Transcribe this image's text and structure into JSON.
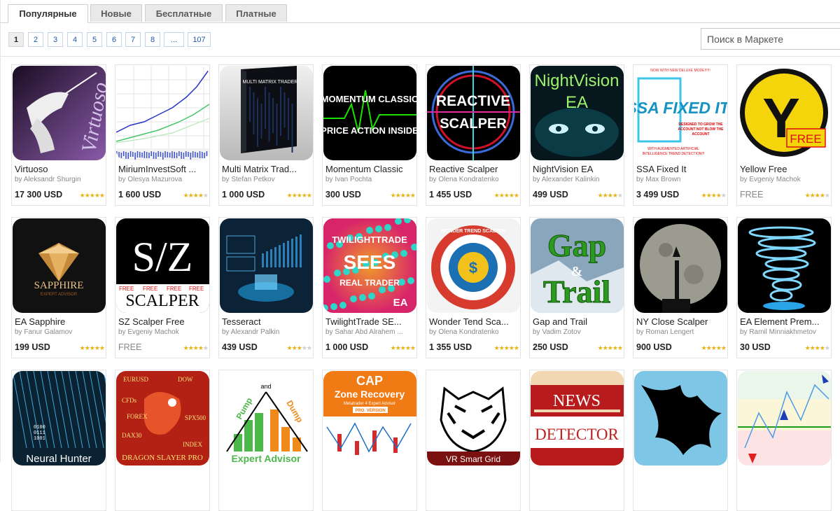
{
  "tabs": [
    "Популярные",
    "Новые",
    "Бесплатные",
    "Платные"
  ],
  "pagination": {
    "pages": [
      "1",
      "2",
      "3",
      "4",
      "5",
      "6",
      "7",
      "8",
      "...",
      "107"
    ],
    "current": "1"
  },
  "search": {
    "placeholder": "Поиск в Маркете"
  },
  "products": [
    {
      "name": "Virtuoso",
      "author": "by Aleksandr Shurgin",
      "price": "17 300 USD",
      "rating": 5,
      "thumb": "virtuoso",
      "thumb_text": [
        "Virtuoso"
      ]
    },
    {
      "name": "MiriumInvestSoft ...",
      "author": "by Olesya Mazurova",
      "price": "1 600 USD",
      "rating": 4,
      "thumb": "mirium",
      "thumb_text": []
    },
    {
      "name": "Multi Matrix Trad...",
      "author": "by Stefan Petkov",
      "price": "1 000 USD",
      "rating": 5,
      "thumb": "matrix",
      "thumb_text": [
        "MULTI MATRIX TRADER"
      ]
    },
    {
      "name": "Momentum Classic",
      "author": "by Ivan Pochta",
      "price": "300 USD",
      "rating": 5,
      "thumb": "momentum",
      "thumb_text": [
        "MOMENTUM CLASSIC",
        "PRICE ACTION INSIDE"
      ]
    },
    {
      "name": "Reactive Scalper",
      "author": "by Olena Kondratenko",
      "price": "1 455 USD",
      "rating": 5,
      "thumb": "reactive",
      "thumb_text": [
        "REACTIVE",
        "SCALPER"
      ]
    },
    {
      "name": "NightVision EA",
      "author": "by Alexander Kalinkin",
      "price": "499 USD",
      "rating": 4,
      "thumb": "nightvision",
      "thumb_text": [
        "NightVision",
        "EA"
      ]
    },
    {
      "name": "SSA Fixed It",
      "author": "by Max Brown",
      "price": "3 499 USD",
      "rating": 4,
      "thumb": "ssa",
      "thumb_text": [
        "NOW WITH NEW DELUXE MODE!!!!!!",
        "SSA FIXED IT!",
        "DESIGNED TO GROW THE",
        "ACCOUNT NOT BLOW THE",
        "ACCOUNT",
        "WITH AUGMENTED ARTIFICIAL",
        "INTELLIGENCE TREND DETECTION!!!"
      ]
    },
    {
      "name": "Yellow Free",
      "author": "by Evgeniy Machok",
      "price": "FREE",
      "rating": 4,
      "thumb": "yellow",
      "thumb_text": [
        "Y",
        "FREE"
      ]
    },
    {
      "name": "EA Sapphire",
      "author": "by Fanur Galamov",
      "price": "199 USD",
      "rating": 5,
      "thumb": "sapphire",
      "thumb_text": [
        "SAPPHIRE",
        "EXPERT ADVISOR"
      ]
    },
    {
      "name": "SZ Scalper Free",
      "author": "by Evgeniy Machok",
      "price": "FREE",
      "rating": 4,
      "thumb": "sz",
      "thumb_text": [
        "S/Z",
        "FREE",
        "FREE",
        "FREE",
        "FREE",
        "SCALPER"
      ]
    },
    {
      "name": "Tesseract",
      "author": "by Alexandr Palkin",
      "price": "439 USD",
      "rating": 3,
      "thumb": "tesseract",
      "thumb_text": []
    },
    {
      "name": "TwilightTrade SE...",
      "author": "by Sahar Abd Alrahem ...",
      "price": "1 000 USD",
      "rating": 5,
      "thumb": "twilight",
      "thumb_text": [
        "TWILIGHTTRADE",
        "SEES",
        "REAL TRADER",
        "EA"
      ]
    },
    {
      "name": "Wonder Tend Sca...",
      "author": "by Olena Kondratenko",
      "price": "1 355 USD",
      "rating": 5,
      "thumb": "wonder",
      "thumb_text": [
        "WONDER TREND SCALPER",
        "$"
      ]
    },
    {
      "name": "Gap and Trail",
      "author": "by Vadim Zotov",
      "price": "250 USD",
      "rating": 5,
      "thumb": "gap",
      "thumb_text": [
        "Gap",
        "&",
        "Trail"
      ]
    },
    {
      "name": "NY Close Scalper",
      "author": "by Roman Lengert",
      "price": "900 USD",
      "rating": 5,
      "thumb": "ny",
      "thumb_text": []
    },
    {
      "name": "EA Element Prem...",
      "author": "by Ramil Minniakhmetov",
      "price": "30 USD",
      "rating": 4,
      "thumb": "element",
      "thumb_text": []
    },
    {
      "name": "",
      "author": "",
      "price": "",
      "rating": 0,
      "thumb": "neural",
      "thumb_text": [
        "Neural Hunter",
        "0100",
        "0111",
        "1001"
      ]
    },
    {
      "name": "",
      "author": "",
      "price": "",
      "rating": 0,
      "thumb": "dragon",
      "thumb_text": [
        "EURUSD",
        "DOW",
        "CFDs",
        "FOREX",
        "SPX500",
        "DAX30",
        "INDEX",
        "DRAGON SLAYER PRO"
      ]
    },
    {
      "name": "",
      "author": "",
      "price": "",
      "rating": 0,
      "thumb": "pump",
      "thumb_text": [
        "and",
        "Pump",
        "Dump",
        "Expert Advisor"
      ]
    },
    {
      "name": "",
      "author": "",
      "price": "",
      "rating": 0,
      "thumb": "cap",
      "thumb_text": [
        "CAP",
        "Zone Recovery",
        "Metatrader 4 Expert Advisor",
        "PRO. VERSION"
      ]
    },
    {
      "name": "",
      "author": "",
      "price": "",
      "rating": 0,
      "thumb": "tiger",
      "thumb_text": [
        "VR Smart Grid"
      ]
    },
    {
      "name": "",
      "author": "",
      "price": "",
      "rating": 0,
      "thumb": "news",
      "thumb_text": [
        "NEWS",
        "DETECTOR"
      ]
    },
    {
      "name": "",
      "author": "",
      "price": "",
      "rating": 0,
      "thumb": "bat",
      "thumb_text": []
    },
    {
      "name": "",
      "author": "",
      "price": "",
      "rating": 0,
      "thumb": "arrows",
      "thumb_text": []
    }
  ],
  "colors": {
    "link": "#1f58a8",
    "star": "#e7b414",
    "tab_bg": "#e9e9e9"
  }
}
